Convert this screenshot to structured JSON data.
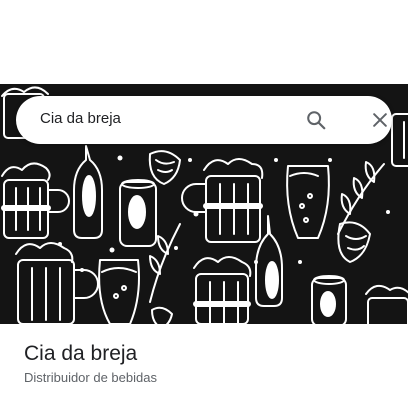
{
  "search": {
    "query": "Cia da breja",
    "search_icon": "search-icon",
    "close_icon": "close-icon"
  },
  "hero": {
    "pattern": "beer-doodle-pattern",
    "background_color": "#141414",
    "stroke_color": "#ffffff"
  },
  "place": {
    "name": "Cia da breja",
    "category": "Distribuidor de bebidas"
  }
}
